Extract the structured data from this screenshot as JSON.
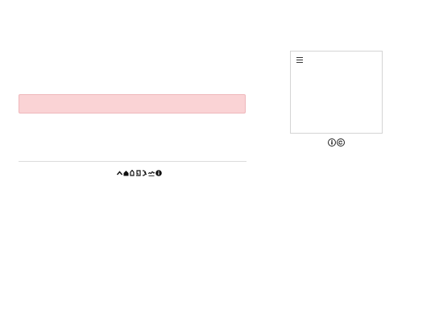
{
  "alert": {
    "background": "#fad3d5",
    "border": "#efb7bb"
  },
  "footer": {
    "icons": [
      "chevron-up-icon",
      "home-icon",
      "lamp-icon",
      "spiral-icon",
      "swirl-icon",
      "squiggle-icon",
      "info-icon"
    ]
  },
  "widget": {
    "menu_icon": "hamburger-menu-icon"
  },
  "license": {
    "icons": [
      "cc-by-icon",
      "cc-sa-icon"
    ]
  }
}
